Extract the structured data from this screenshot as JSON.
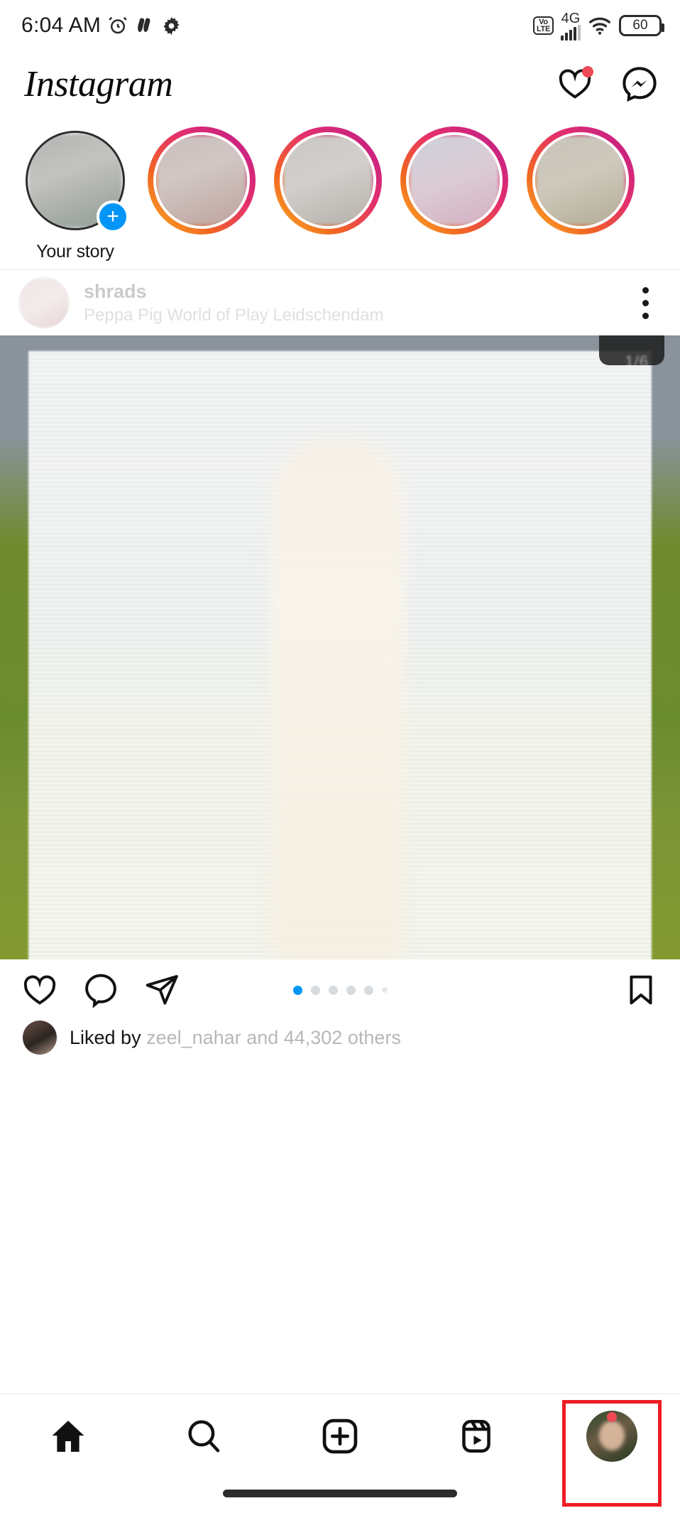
{
  "status_bar": {
    "time": "6:04 AM",
    "alarm_icon": "alarm-icon",
    "dnd_icon": "dnd-icon",
    "settings_icon": "gear-icon",
    "volte_top": "Vo",
    "volte_bottom": "LTE",
    "network": "4G",
    "wifi_icon": "wifi-icon",
    "battery_level": "60"
  },
  "header": {
    "logo": "Instagram",
    "heart_icon": "heart-icon",
    "messenger_icon": "messenger-icon",
    "notification_dot_color": "#ED4956"
  },
  "stories": {
    "items": [
      {
        "label": "Your story",
        "has_ring": false,
        "has_add_badge": true
      },
      {
        "label": "",
        "has_ring": true,
        "has_add_badge": false
      },
      {
        "label": "",
        "has_ring": true,
        "has_add_badge": false
      },
      {
        "label": "",
        "has_ring": true,
        "has_add_badge": false
      },
      {
        "label": "",
        "has_ring": true,
        "has_add_badge": false
      }
    ],
    "ring_gradient_start": "#F9A825",
    "ring_gradient_end": "#C62184"
  },
  "post": {
    "username": "shrads",
    "location": "Peppa Pig World of Play Leidschendam",
    "menu_icon": "kebab-menu-icon",
    "media_counter": "1/6",
    "like_icon": "heart-icon",
    "comment_icon": "comment-icon",
    "share_icon": "share-icon",
    "save_icon": "bookmark-icon",
    "carousel": {
      "count": 6,
      "active_index": 0
    },
    "liked_by_prefix": "Liked by ",
    "liked_by_user": "zeel_nahar",
    "liked_by_suffix": " and 44,302 others"
  },
  "tabbar": {
    "items": [
      {
        "name": "home",
        "icon": "home-icon",
        "active": true
      },
      {
        "name": "search",
        "icon": "search-icon",
        "active": false
      },
      {
        "name": "create",
        "icon": "plus-square-icon",
        "active": false
      },
      {
        "name": "reels",
        "icon": "reels-icon",
        "active": false
      },
      {
        "name": "profile",
        "icon": "profile-avatar",
        "active": false
      }
    ],
    "highlight_color": "#EE1C25",
    "profile_dot_color": "#ED4956"
  }
}
